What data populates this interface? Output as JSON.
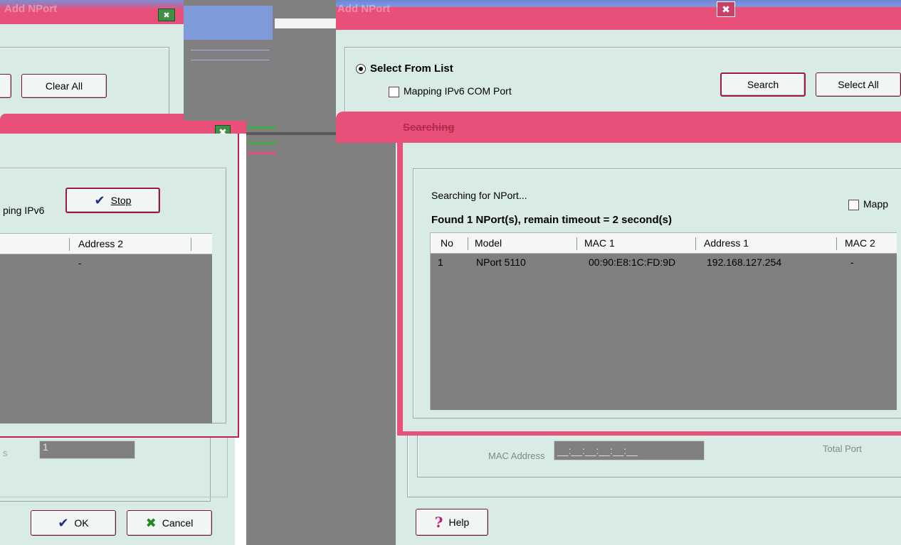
{
  "left_dialog": {
    "title": "Add NPort",
    "clear_all_label": "Clear All",
    "ok_label": "OK",
    "cancel_label": "Cancel",
    "field_value": "1"
  },
  "left_search_dialog": {
    "mapping_ipv6_partial": "ping IPv6",
    "stop_label": "Stop",
    "columns": [
      "Address 2"
    ],
    "row_value": "-"
  },
  "right_dialog": {
    "title": "Add NPort",
    "select_from_list_label": "Select From List",
    "mapping_ipv6_com_label": "Mapping IPv6 COM Port",
    "search_label": "Search",
    "select_all_label": "Select All",
    "mac_address_label": "MAC Address",
    "mac_address_value": "__:__:__:__:__:__",
    "total_ports_label": "Total Port",
    "help_label": "Help"
  },
  "searching_dialog": {
    "title": "Searching",
    "searching_text": "Searching for NPort...",
    "found_text": "Found 1 NPort(s), remain timeout = 2 second(s)",
    "mapping_partial": "Mapp",
    "columns": [
      "No",
      "Model",
      "MAC 1",
      "Address 1",
      "MAC 2"
    ],
    "rows": [
      {
        "no": "1",
        "model": "NPort 5110",
        "mac1": "00:90:E8:1C:FD:9D",
        "address1": "192.168.127.254",
        "mac2": "-"
      }
    ]
  },
  "colors": {
    "title_pink": "#e8507a",
    "dialog_bg": "#d9ebe6",
    "list_bg": "#808080"
  }
}
